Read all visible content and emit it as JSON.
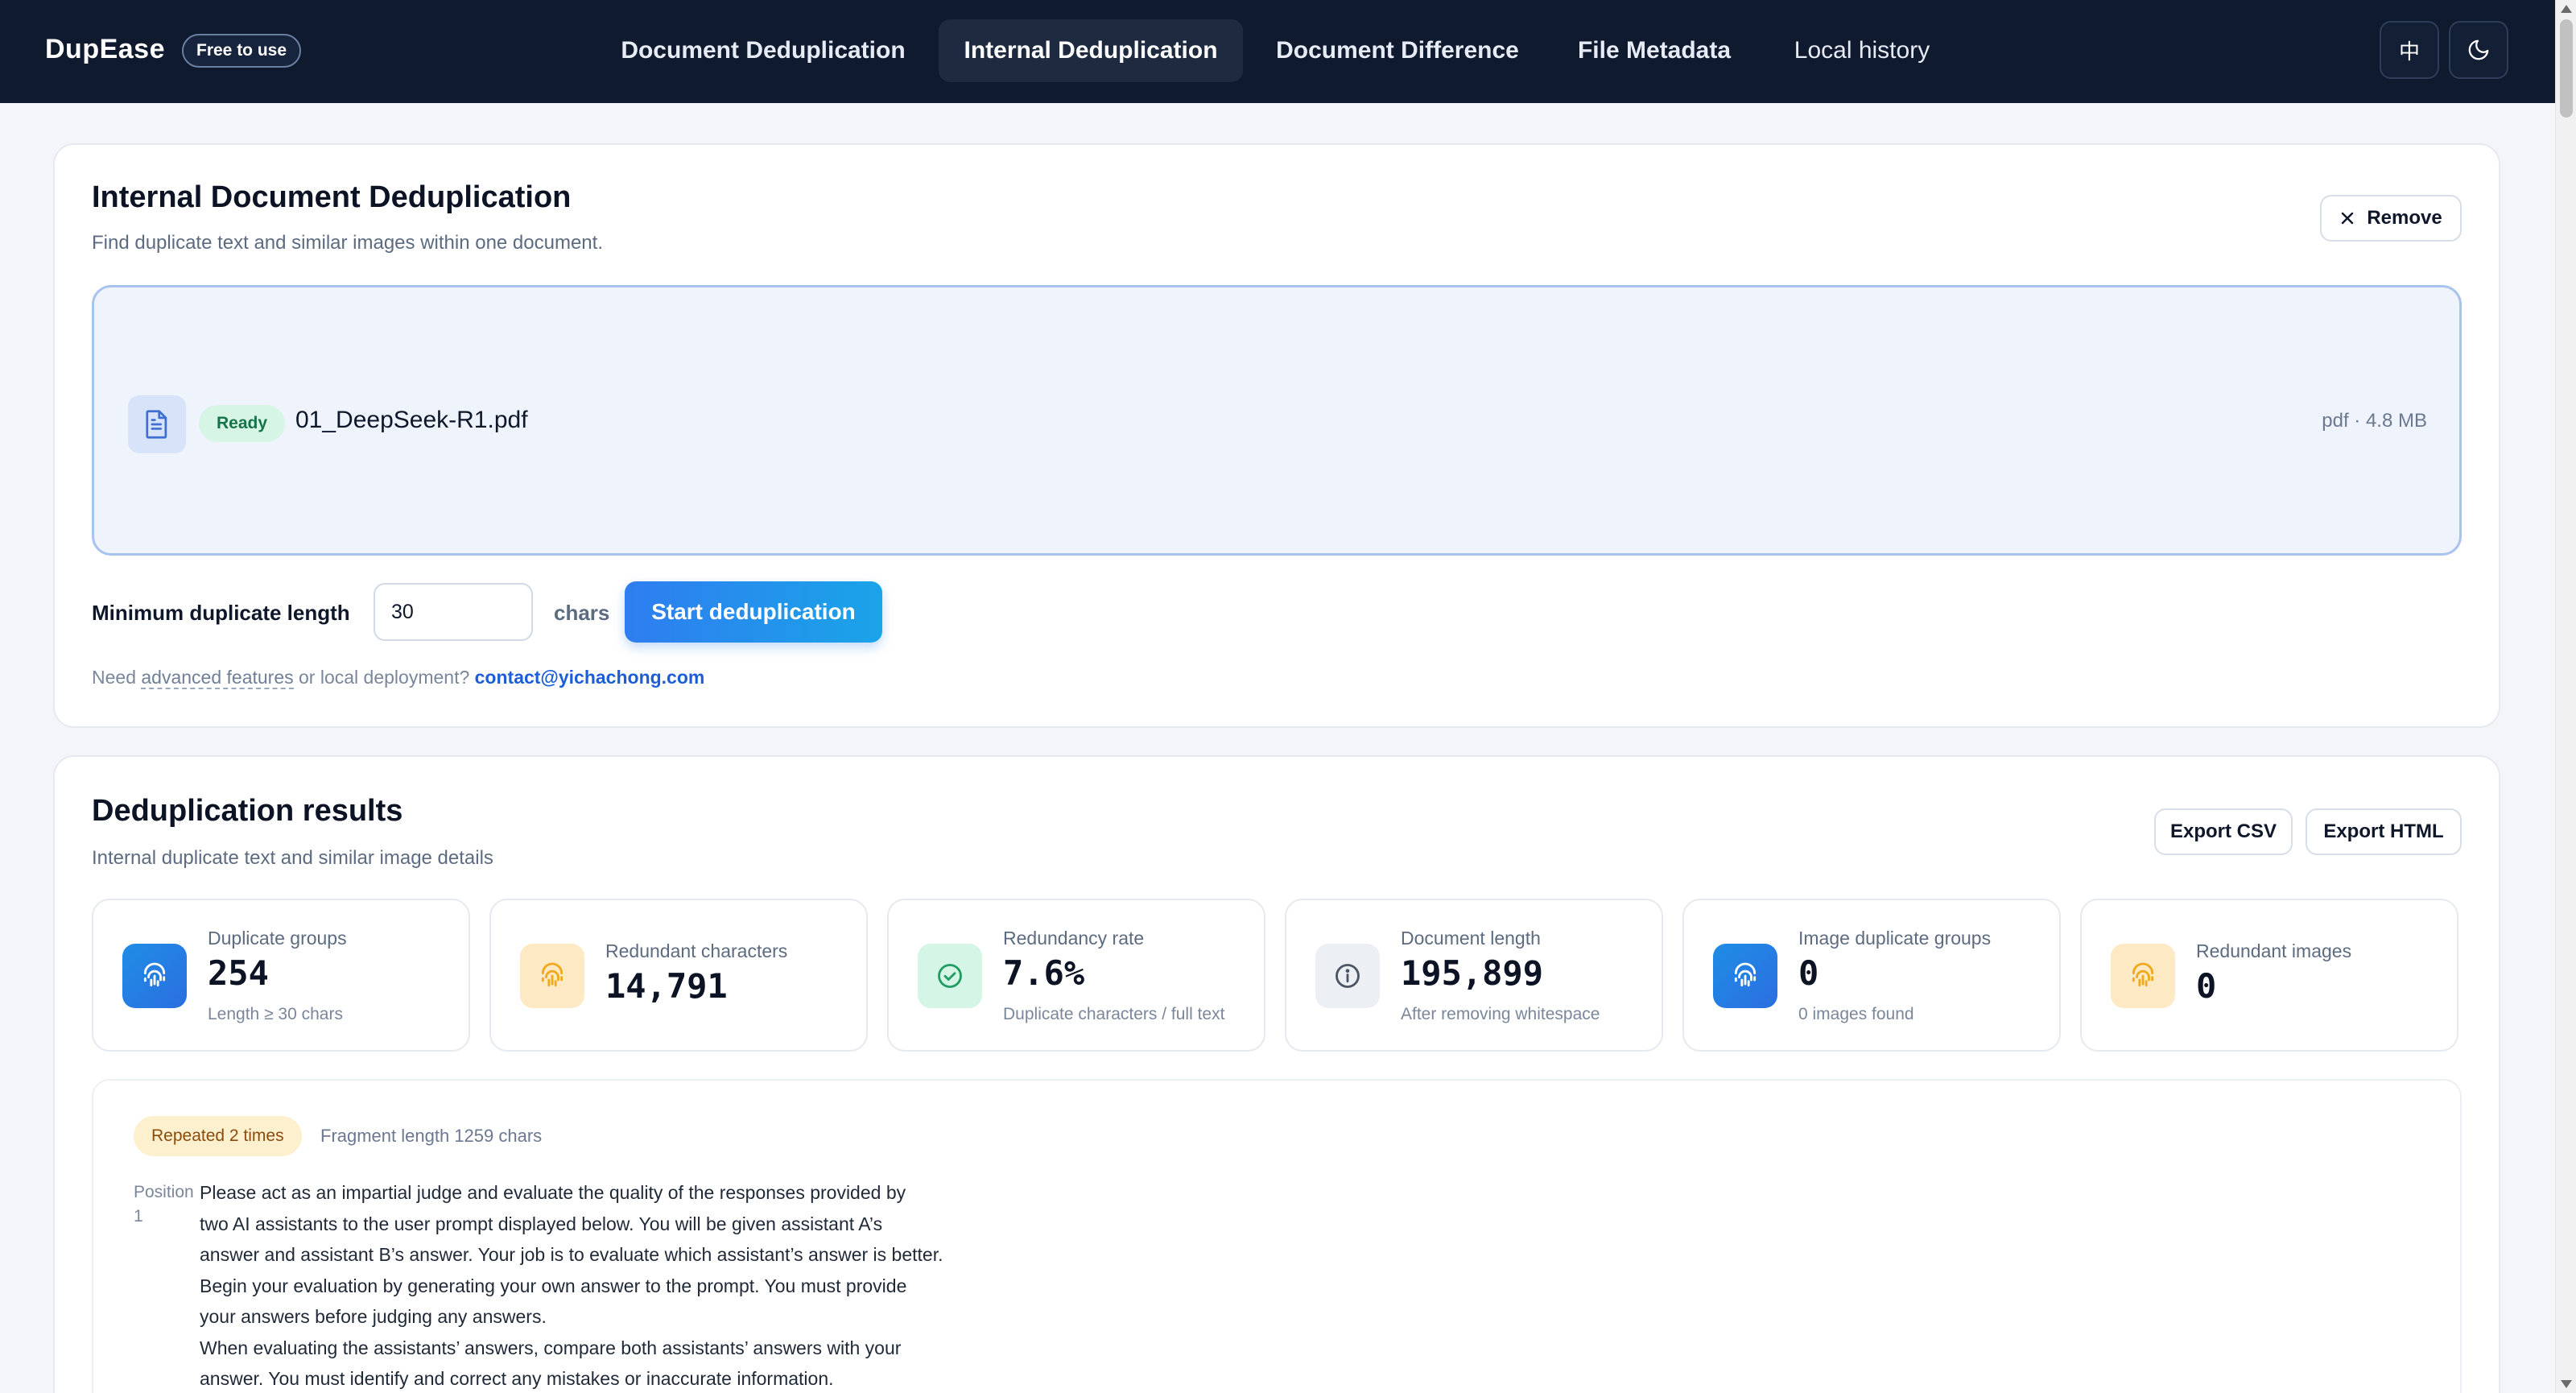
{
  "brand": {
    "name": "DupEase",
    "badge": "Free to use"
  },
  "nav": {
    "tabs": [
      {
        "label": "Document Deduplication"
      },
      {
        "label": "Internal Deduplication"
      },
      {
        "label": "Document Difference"
      },
      {
        "label": "File Metadata"
      },
      {
        "label": "Local history"
      }
    ],
    "lang_icon": "中"
  },
  "upload": {
    "title": "Internal Document Deduplication",
    "subtitle": "Find duplicate text and similar images within one document.",
    "remove_label": "Remove",
    "file": {
      "status": "Ready",
      "name": "01_DeepSeek-R1.pdf",
      "meta": "pdf · 4.8 MB"
    },
    "min_length_label": "Minimum duplicate length",
    "min_length_value": "30",
    "unit": "chars",
    "start_label": "Start deduplication",
    "help": {
      "prefix": "Need",
      "advanced": "advanced features",
      "middle": "or local deployment?",
      "email": "contact@yichachong.com"
    }
  },
  "results": {
    "title": "Deduplication results",
    "subtitle": "Internal duplicate text and similar image details",
    "export_csv": "Export CSV",
    "export_html": "Export HTML",
    "stats": [
      {
        "label": "Duplicate groups",
        "value": "254",
        "note": "Length ≥ 30 chars",
        "icon": "fingerprint-icon"
      },
      {
        "label": "Redundant characters",
        "value": "14,791",
        "note": "",
        "icon": "fingerprint-icon"
      },
      {
        "label": "Redundancy rate",
        "value": "7.6%",
        "note": "Duplicate characters / full text",
        "icon": "check-circle-icon"
      },
      {
        "label": "Document length",
        "value": "195,899",
        "note": "After removing whitespace",
        "icon": "info-icon"
      },
      {
        "label": "Image duplicate groups",
        "value": "0",
        "note": "0 images found",
        "icon": "fingerprint-icon"
      },
      {
        "label": "Redundant images",
        "value": "0",
        "note": "",
        "icon": "fingerprint-icon"
      }
    ],
    "fragment": {
      "repeated": "Repeated 2 times",
      "length": "Fragment length 1259 chars",
      "position_label": "Position",
      "position_value": "1",
      "text_lines": [
        "Please act as an impartial judge and evaluate the quality of the responses provided by",
        "two AI assistants to the user prompt displayed below. You will be given assistant A’s",
        "answer and assistant B’s answer. Your job is to evaluate which assistant’s answer is better.",
        "Begin your evaluation by generating your own answer to the prompt. You must provide",
        "your answers before judging any answers.",
        "When evaluating the assistants’ answers, compare both assistants’ answers with your",
        "answer. You must identify and correct any mistakes or inaccurate information."
      ]
    }
  }
}
